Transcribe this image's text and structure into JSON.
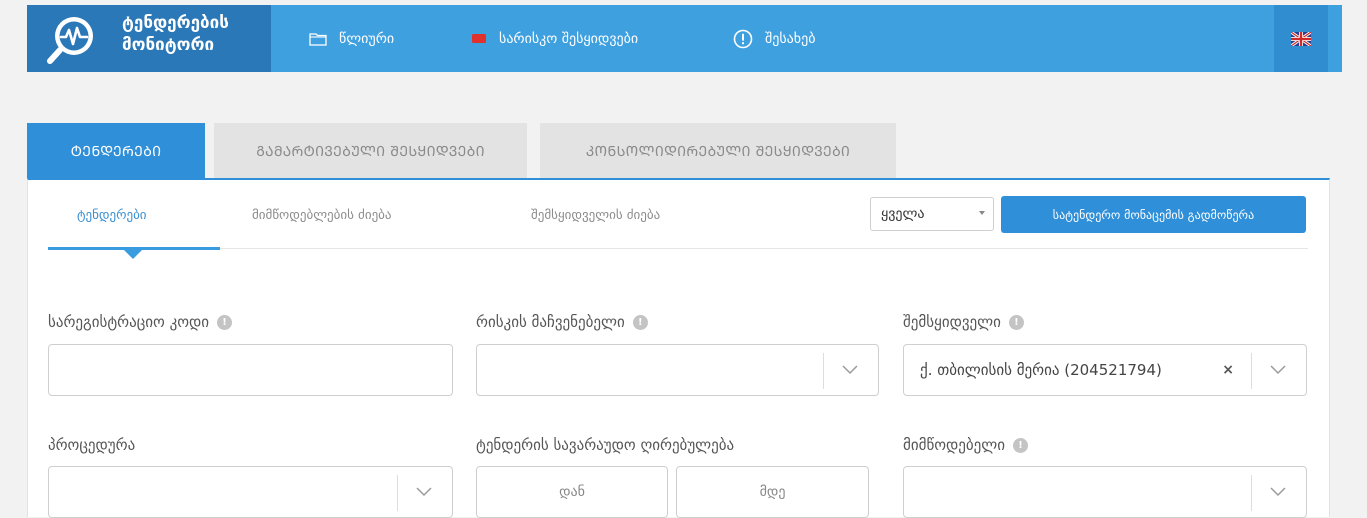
{
  "header": {
    "logo_line1": "ტენდერების",
    "logo_line2": "მონიტორი",
    "nav": [
      {
        "label": "წლიური",
        "icon": "folder-icon"
      },
      {
        "label": "სარისკო შესყიდვები",
        "icon": "flag-icon"
      },
      {
        "label": "შესახებ",
        "icon": "info-circle-icon"
      }
    ],
    "language_icon": "uk-flag-icon",
    "colors": {
      "bar": "#3fa0e0",
      "logo_bg": "#2a78b8",
      "accent": "#2f8fd8"
    }
  },
  "main_tabs": [
    {
      "label": "ᲢᲔᲜᲓᲔᲠᲔᲑᲘ",
      "active": true
    },
    {
      "label": "ᲒᲐᲛᲐᲠᲢᲘᲕᲔᲑᲣᲚᲘ ᲨᲔᲡᲧᲘᲓᲕᲔᲑᲘ",
      "active": false
    },
    {
      "label": "ᲙᲝᲜᲡᲝᲚᲘᲓᲘᲠᲔᲑᲣᲚᲘ ᲨᲔᲡᲧᲘᲓᲕᲔᲑᲘ",
      "active": false
    }
  ],
  "sub_tabs": [
    {
      "label": "ტენდერები",
      "active": true
    },
    {
      "label": "მიმწოდებლების ძიება",
      "active": false
    },
    {
      "label": "შემსყიდველის ძიება",
      "active": false
    }
  ],
  "filter": {
    "selected": "ყველა"
  },
  "download_button": "სატენდერო მონაცემის გადმოწერა",
  "form": {
    "registration_code": {
      "label": "სარეგისტრაციო კოდი",
      "value": ""
    },
    "risk_indicator": {
      "label": "რისკის მაჩვენებელი",
      "value": ""
    },
    "purchaser": {
      "label": "შემსყიდველი",
      "value": "ქ. თბილისის მერია (204521794)",
      "clear": "×"
    },
    "procedure": {
      "label": "პროცედურა",
      "value": ""
    },
    "estimated_value": {
      "label": "ტენდერის სავარაუდო ღირებულება",
      "from_placeholder": "დან",
      "to_placeholder": "მდე"
    },
    "supplier": {
      "label": "მიმწოდებელი",
      "value": ""
    }
  }
}
